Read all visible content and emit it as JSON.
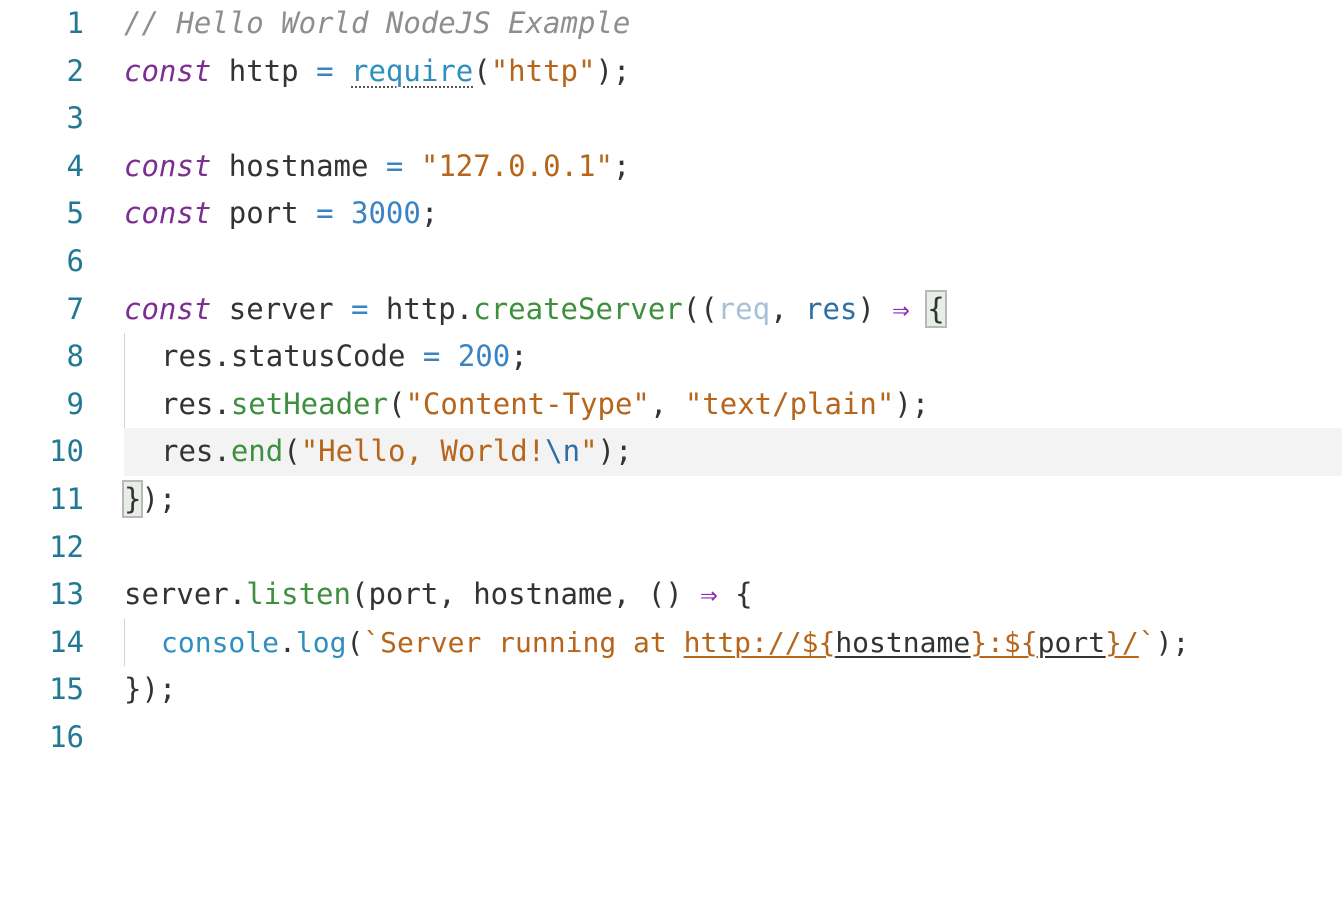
{
  "editor": {
    "language": "JavaScript",
    "current_line": 10,
    "line_numbers": [
      "1",
      "2",
      "3",
      "4",
      "5",
      "6",
      "7",
      "8",
      "9",
      "10",
      "11",
      "12",
      "13",
      "14",
      "15",
      "16"
    ],
    "lines": {
      "l1": {
        "comment": "// Hello World NodeJS Example"
      },
      "l2": {
        "kw": "const",
        "name": " http ",
        "eq": "=",
        "sp": " ",
        "fn": "require",
        "open": "(",
        "str": "\"http\"",
        "close": ");"
      },
      "l4": {
        "kw": "const",
        "name": " hostname ",
        "eq": "=",
        "sp": " ",
        "str": "\"127.0.0.1\"",
        "end": ";"
      },
      "l5": {
        "kw": "const",
        "name": " port ",
        "eq": "=",
        "sp": " ",
        "num": "3000",
        "end": ";"
      },
      "l7": {
        "kw": "const",
        "name": " server ",
        "eq": "=",
        "sp": " http.",
        "fn": "createServer",
        "open": "((",
        "p1": "req",
        "comma": ", ",
        "p2": "res",
        "close": ") ",
        "arrow": "⇒",
        "sp2": " ",
        "brace": "{"
      },
      "l8": {
        "obj": "res.statusCode ",
        "eq": "=",
        "sp": " ",
        "num": "200",
        "end": ";"
      },
      "l9": {
        "obj": "res.",
        "fn": "setHeader",
        "open": "(",
        "s1": "\"Content-Type\"",
        "comma": ", ",
        "s2": "\"text/plain\"",
        "close": ");"
      },
      "l10": {
        "obj": "res.",
        "fn": "end",
        "open": "(",
        "s1": "\"Hello, World!",
        "esc": "\\n",
        "s2": "\"",
        "close": ");"
      },
      "l11": {
        "brace": "}",
        "close": ");"
      },
      "l13": {
        "obj": "server.",
        "fn": "listen",
        "open": "(port, hostname, () ",
        "arrow": "⇒",
        "sp": " ",
        "brace": "{"
      },
      "l14": {
        "obj": "console",
        "dot": ".",
        "fn": "log",
        "open": "(",
        "t1": "`Server running at ",
        "t2": "http://${",
        "v1": "hostname",
        "t3": "}:${",
        "v2": "port",
        "t4": "}/",
        "t5": "`",
        "close": ");"
      },
      "l15": {
        "close": "});"
      }
    },
    "colors": {
      "keyword": "#7b2f90",
      "string": "#b6651b",
      "number": "#3a84c4",
      "function": "#3e8f3e",
      "comment": "#8e8e8e",
      "line_number": "#237893",
      "current_line_bg": "#f3f3f3"
    }
  }
}
